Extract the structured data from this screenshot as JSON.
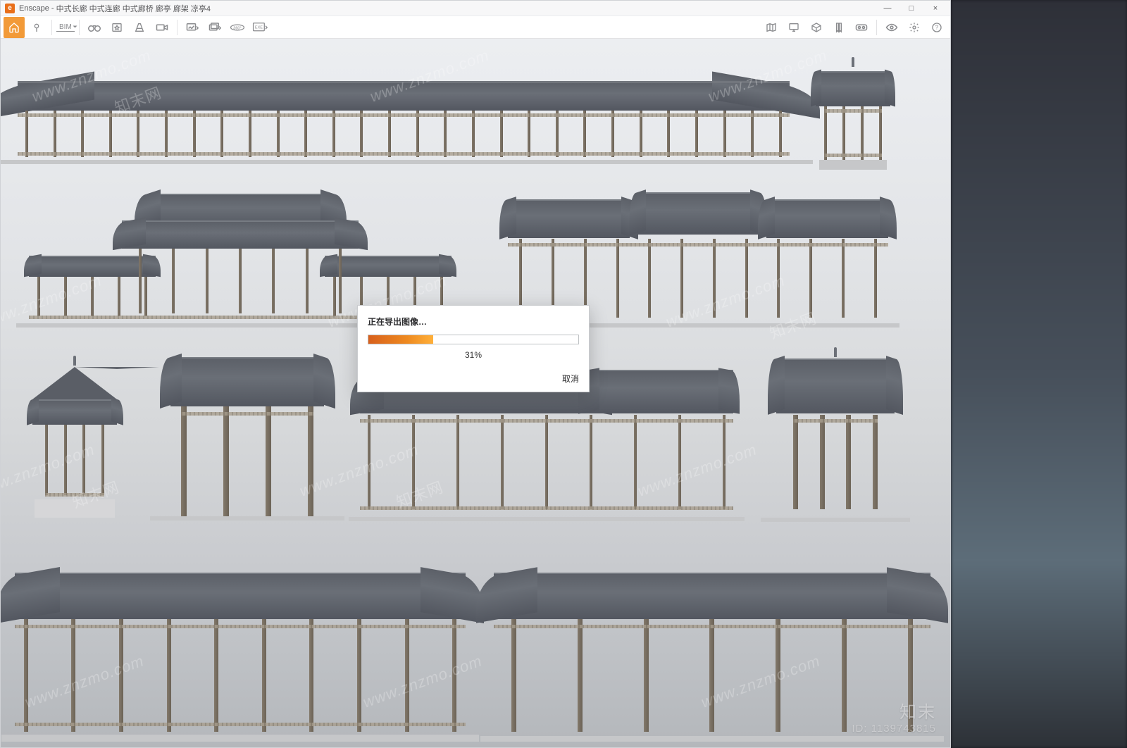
{
  "app": {
    "name": "Enscape",
    "title_suffix": "中式长廊 中式连廊 中式廊桥 廊亭 廊架 凉亭4"
  },
  "window_controls": {
    "minimize": "—",
    "maximize": "□",
    "close": "×"
  },
  "toolbar": {
    "home": "home-icon",
    "pin": "pin-icon",
    "bim_label": "BIM",
    "binoculars": "binoculars-icon",
    "favorites": "favorites-icon",
    "perspective": "perspective-icon",
    "video": "video-icon",
    "export_image": "export-image-icon",
    "export_batch": "export-batch-icon",
    "panorama_360": "360°",
    "export_exe": "EXE",
    "map": "map-icon",
    "monitor": "monitor-icon",
    "box": "box-icon",
    "bookmark": "bookmark-icon",
    "vr": "vr-icon",
    "visibility": "visibility-icon",
    "settings": "settings-icon",
    "help": "?"
  },
  "dialog": {
    "title": "正在导出图像…",
    "percent_value": 31,
    "percent_label": "31%",
    "cancel": "取消"
  },
  "watermark": {
    "url": "www.znzmo.com",
    "cn": "知末网",
    "corner_brand": "知末",
    "corner_id_label": "ID: 1139743815"
  }
}
